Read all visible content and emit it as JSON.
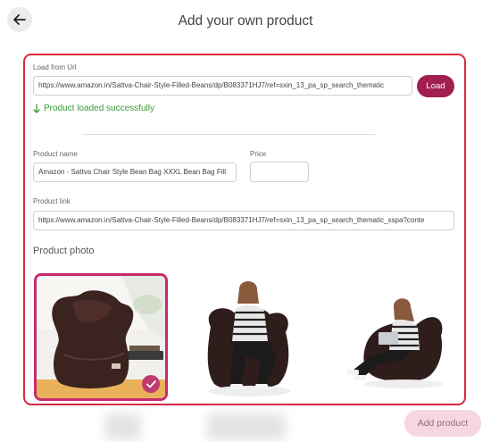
{
  "header": {
    "title": "Add your own product",
    "back_icon": "arrow-left-icon"
  },
  "form": {
    "url_label": "Load from Url",
    "url_value": "https://www.amazon.in/Sattva-Chair-Style-Filled-Beans/dp/B083371HJ7/ref=sxin_13_pa_sp_search_thematic",
    "load_label": "Load",
    "status_text": "Product loaded successfully",
    "name_label": "Product name",
    "name_value": "Amazon - Sattva Chair Style Bean Bag XXXL Bean Bag Fill",
    "price_label": "Price",
    "price_value": "",
    "link_label": "Product link",
    "link_value": "https://www.amazon.in/Sattva-Chair-Style-Filled-Beans/dp/B083371HJ7/ref=sxin_13_pa_sp_search_thematic_sspa?conte",
    "photo_label": "Product photo"
  },
  "photos": {
    "selected_index": 0,
    "check_icon": "check-icon"
  },
  "footer": {
    "add_label": "Add product"
  },
  "colors": {
    "accent": "#a21f52",
    "border": "#d9283f",
    "success": "#3a9a3a"
  }
}
